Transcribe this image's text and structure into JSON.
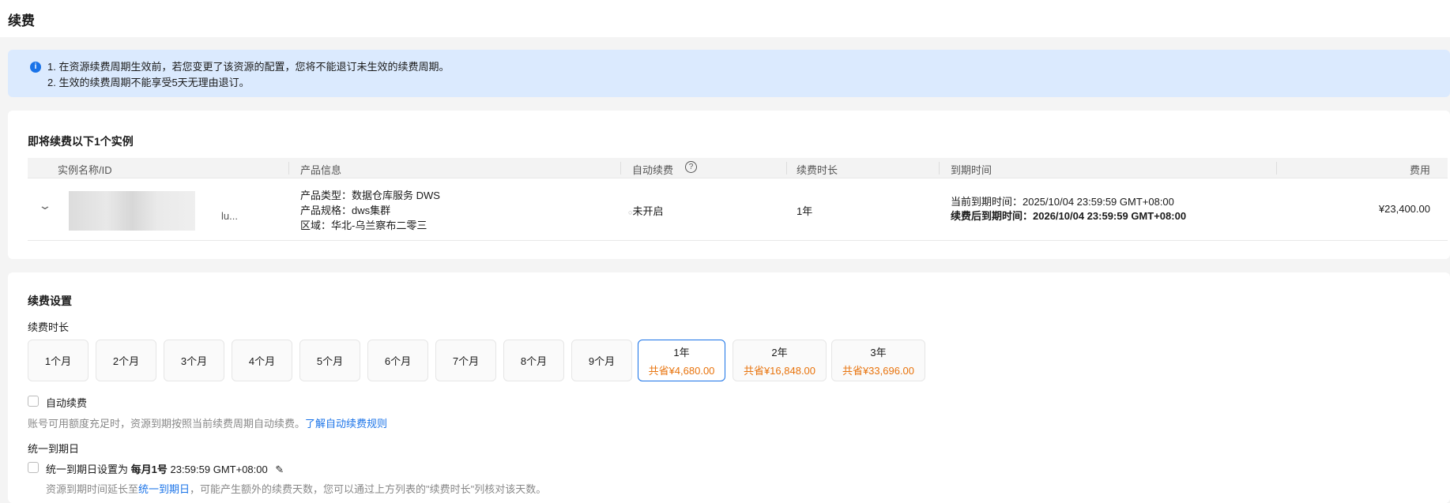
{
  "title": "续费",
  "notice": {
    "line1": "1. 在资源续费周期生效前，若您变更了该资源的配置，您将不能退订未生效的续费周期。",
    "line2": "2. 生效的续费周期不能享受5天无理由退订。"
  },
  "instances": {
    "heading": "即将续费以下1个实例",
    "columns": [
      "实例名称/ID",
      "产品信息",
      "自动续费",
      "续费时长",
      "到期时间",
      "费用"
    ],
    "row": {
      "name_suffix": "lu...",
      "product_type": "产品类型：数据仓库服务 DWS",
      "product_spec": "产品规格：dws集群",
      "region": "区域：华北-乌兰察布二零三",
      "auto_renew": "未开启",
      "duration": "1年",
      "current_expiry": "当前到期时间：2025/10/04 23:59:59 GMT+08:00",
      "new_expiry": "续费后到期时间：2026/10/04 23:59:59 GMT+08:00",
      "fee": "¥23,400.00"
    }
  },
  "settings": {
    "heading": "续费设置",
    "duration_label": "续费时长",
    "options": [
      {
        "label": "1个月"
      },
      {
        "label": "2个月"
      },
      {
        "label": "3个月"
      },
      {
        "label": "4个月"
      },
      {
        "label": "5个月"
      },
      {
        "label": "6个月"
      },
      {
        "label": "7个月"
      },
      {
        "label": "8个月"
      },
      {
        "label": "9个月"
      },
      {
        "label": "1年",
        "save": "共省¥4,680.00",
        "selected": true
      },
      {
        "label": "2年",
        "save": "共省¥16,848.00"
      },
      {
        "label": "3年",
        "save": "共省¥33,696.00"
      }
    ],
    "auto_renew_label": "自动续费",
    "auto_renew_hint": "账号可用额度充足时，资源到期按照当前续费周期自动续费。",
    "auto_renew_link": "了解自动续费规则",
    "unify_heading": "统一到期日",
    "unify_label_pre": "统一到期日设置为",
    "unify_day": "每月1号",
    "unify_time": "23:59:59 GMT+08:00",
    "unify_hint_pre": "资源到期时间延长至",
    "unify_hint_link": "统一到期日",
    "unify_hint_post": "，可能产生额外的续费天数，您可以通过上方列表的\"续费时长\"列核对该天数。"
  },
  "colors": {
    "accent": "#1a73e8",
    "save": "#e8730c"
  }
}
